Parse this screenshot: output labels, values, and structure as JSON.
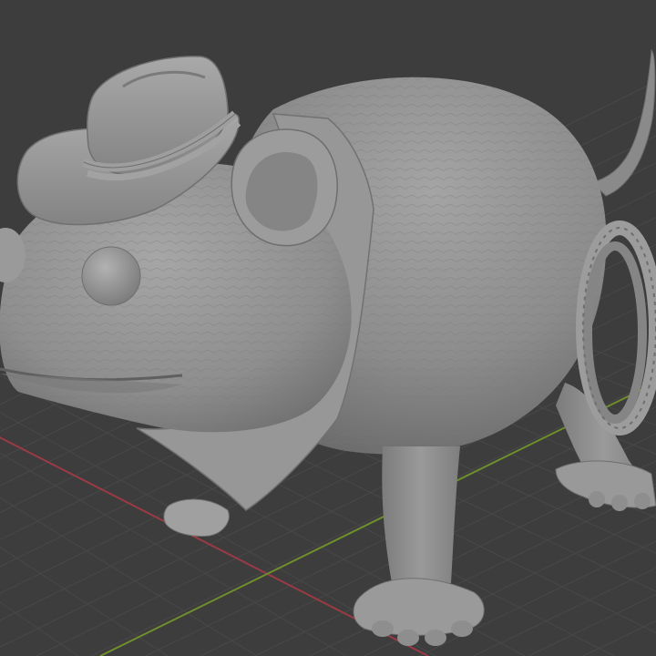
{
  "viewport": {
    "background": "#3d3d3d",
    "grid_color": "#484848",
    "x_axis_color": "#9a3a44",
    "y_axis_color": "#6f8f2c",
    "model_color": "#8f8f8f"
  },
  "model": {
    "subject": "rat-in-cowboy-hat",
    "parts": [
      "body",
      "head",
      "ear",
      "eye",
      "cowboy-hat",
      "hat-band",
      "bandana",
      "tail",
      "lasso",
      "front-leg",
      "back-leg",
      "paws"
    ]
  }
}
